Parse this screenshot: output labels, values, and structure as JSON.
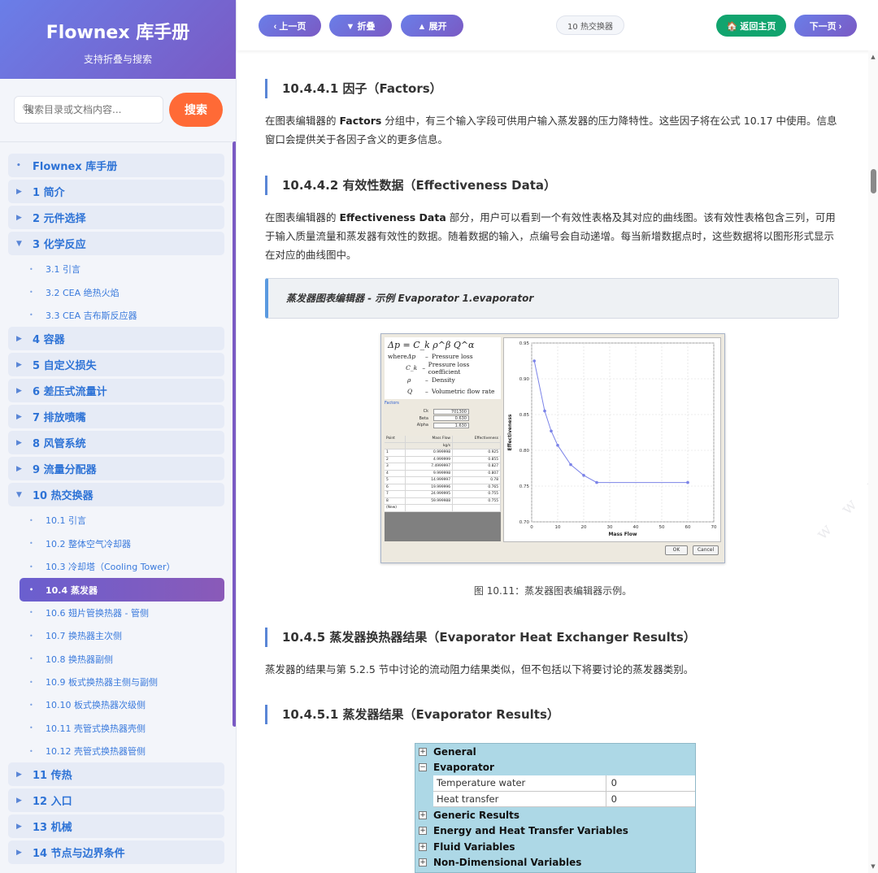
{
  "sidebar": {
    "title": "Flownex 库手册",
    "subtitle": "支持折叠与搜索",
    "search_placeholder": "搜索目录或文档内容...",
    "search_button": "搜索",
    "toc": [
      {
        "type": "item",
        "marker": "•",
        "label": "Flownex 库手册"
      },
      {
        "type": "item",
        "marker": "▶",
        "label": "1 简介"
      },
      {
        "type": "item",
        "marker": "▶",
        "label": "2 元件选择"
      },
      {
        "type": "item",
        "marker": "▼",
        "label": "3 化学反应"
      },
      {
        "type": "sub",
        "label": "3.1 引言"
      },
      {
        "type": "sub",
        "label": "3.2 CEA 绝热火焰"
      },
      {
        "type": "sub",
        "label": "3.3 CEA 吉布斯反应器"
      },
      {
        "type": "item",
        "marker": "▶",
        "label": "4 容器"
      },
      {
        "type": "item",
        "marker": "▶",
        "label": "5 自定义损失"
      },
      {
        "type": "item",
        "marker": "▶",
        "label": "6 差压式流量计"
      },
      {
        "type": "item",
        "marker": "▶",
        "label": "7 排放喷嘴"
      },
      {
        "type": "item",
        "marker": "▶",
        "label": "8 风管系统"
      },
      {
        "type": "item",
        "marker": "▶",
        "label": "9 流量分配器"
      },
      {
        "type": "item",
        "marker": "▼",
        "label": "10 热交换器"
      },
      {
        "type": "sub",
        "label": "10.1 引言"
      },
      {
        "type": "sub",
        "label": "10.2 整体空气冷却器"
      },
      {
        "type": "sub",
        "label": "10.3 冷却塔（Cooling Tower）"
      },
      {
        "type": "sub",
        "label": "10.4 蒸发器",
        "active": true
      },
      {
        "type": "sub",
        "label": "10.6 翅片管换热器 - 管侧"
      },
      {
        "type": "sub",
        "label": "10.7 换热器主次侧"
      },
      {
        "type": "sub",
        "label": "10.8 换热器副侧"
      },
      {
        "type": "sub",
        "label": "10.9 板式换热器主侧与副侧"
      },
      {
        "type": "sub",
        "label": "10.10 板式换热器次级侧"
      },
      {
        "type": "sub",
        "label": "10.11 壳管式换热器壳侧"
      },
      {
        "type": "sub",
        "label": "10.12 壳管式换热器管侧"
      },
      {
        "type": "item",
        "marker": "▶",
        "label": "11 传热"
      },
      {
        "type": "item",
        "marker": "▶",
        "label": "12 入口"
      },
      {
        "type": "item",
        "marker": "▶",
        "label": "13 机械"
      },
      {
        "type": "item",
        "marker": "▶",
        "label": "14 节点与边界条件"
      }
    ]
  },
  "topbar": {
    "prev": "‹ 上一页",
    "collapse": "▼ 折叠",
    "expand": "▲ 展开",
    "chapter": "10 热交换器",
    "home": "🏠 返回主页",
    "next": "下一页 ›"
  },
  "content": {
    "h1": "10.4.4.1 因子（Factors）",
    "p1_a": "在图表编辑器的 ",
    "p1_b": "Factors",
    "p1_c": " 分组中，有三个输入字段可供用户输入蒸发器的压力降特性。这些因子将在公式 10.17 中使用。信息窗口会提供关于各因子含义的更多信息。",
    "h2": "10.4.4.2 有效性数据（Effectiveness Data）",
    "p2_a": "在图表编辑器的 ",
    "p2_b": "Effectiveness Data",
    "p2_c": " 部分，用户可以看到一个有效性表格及其对应的曲线图。该有效性表格包含三列，可用于输入质量流量和蒸发器有效性的数据。随着数据的输入，点编号会自动递增。每当新增数据点时，这些数据将以图形形式显示在对应的曲线图中。",
    "note": "蒸发器图表编辑器 - 示例 Evaporator 1.evaporator",
    "caption1": "图 10.11：蒸发器图表编辑器示例。",
    "h3": "10.4.5 蒸发器换热器结果（Evaporator Heat Exchanger Results）",
    "p3": "蒸发器的结果与第 5.2.5 节中讨论的流动阻力结果类似，但不包括以下将要讨论的蒸发器类别。",
    "h4": "10.4.5.1 蒸发器结果（Evaporator Results）"
  },
  "figure1": {
    "formula": "Δp = C_k ρ^β Q^α",
    "where": "where",
    "legend": [
      {
        "sym": "Δp",
        "desc": "Pressure loss"
      },
      {
        "sym": "C_k",
        "desc": "Pressure loss coefficient"
      },
      {
        "sym": "ρ",
        "desc": "Density"
      },
      {
        "sym": "Q",
        "desc": "Volumetric flow rate"
      }
    ],
    "factors_label": "Factors",
    "factors": [
      {
        "name": "Ck",
        "value": "701300"
      },
      {
        "name": "Beta",
        "value": "0.630"
      },
      {
        "name": "Alpha",
        "value": "1.630"
      }
    ],
    "grid_headers": [
      "Point",
      "Mass Flow",
      "Effectiveness"
    ],
    "grid_unit": "kg/s",
    "grid_rows": [
      [
        "1",
        "0.999998",
        "0.925"
      ],
      [
        "2",
        "4.999999",
        "0.855"
      ],
      [
        "3",
        "7.4999997",
        "0.827"
      ],
      [
        "4",
        "9.999998",
        "0.807"
      ],
      [
        "5",
        "14.999997",
        "0.78"
      ],
      [
        "6",
        "19.999996",
        "0.765"
      ],
      [
        "7",
        "24.999995",
        "0.755"
      ],
      [
        "8",
        "59.999988",
        "0.755"
      ],
      [
        "(New)",
        "",
        ""
      ]
    ],
    "ok": "OK",
    "cancel": "Cancel"
  },
  "chart_data": {
    "type": "line",
    "x": [
      1,
      5,
      7.5,
      10,
      15,
      20,
      25,
      60
    ],
    "series": [
      {
        "values": [
          0.925,
          0.855,
          0.827,
          0.807,
          0.78,
          0.765,
          0.755,
          0.755
        ]
      }
    ],
    "xlabel": "Mass Flow",
    "ylabel": "Effectiveness",
    "xlim": [
      0,
      70
    ],
    "ylim": [
      0.7,
      0.95
    ],
    "xticks": [
      0,
      10,
      20,
      30,
      40,
      50,
      60,
      70
    ],
    "yticks": [
      0.7,
      0.75,
      0.8,
      0.85,
      0.9,
      0.95
    ],
    "grid": true,
    "color": "#7b83e8"
  },
  "figure2": {
    "groups": [
      {
        "label": "General",
        "expanded": false
      },
      {
        "label": "Evaporator",
        "expanded": true,
        "props": [
          {
            "name": "Temperature water",
            "value": "0"
          },
          {
            "name": "Heat transfer",
            "value": "0"
          }
        ]
      },
      {
        "label": "Generic Results",
        "expanded": false
      },
      {
        "label": "Energy and Heat Transfer Variables",
        "expanded": false
      },
      {
        "label": "Fluid Variables",
        "expanded": false
      },
      {
        "label": "Non-Dimensional Variables",
        "expanded": false
      }
    ]
  },
  "watermark": "w w w . t e c h - d o c . c n"
}
